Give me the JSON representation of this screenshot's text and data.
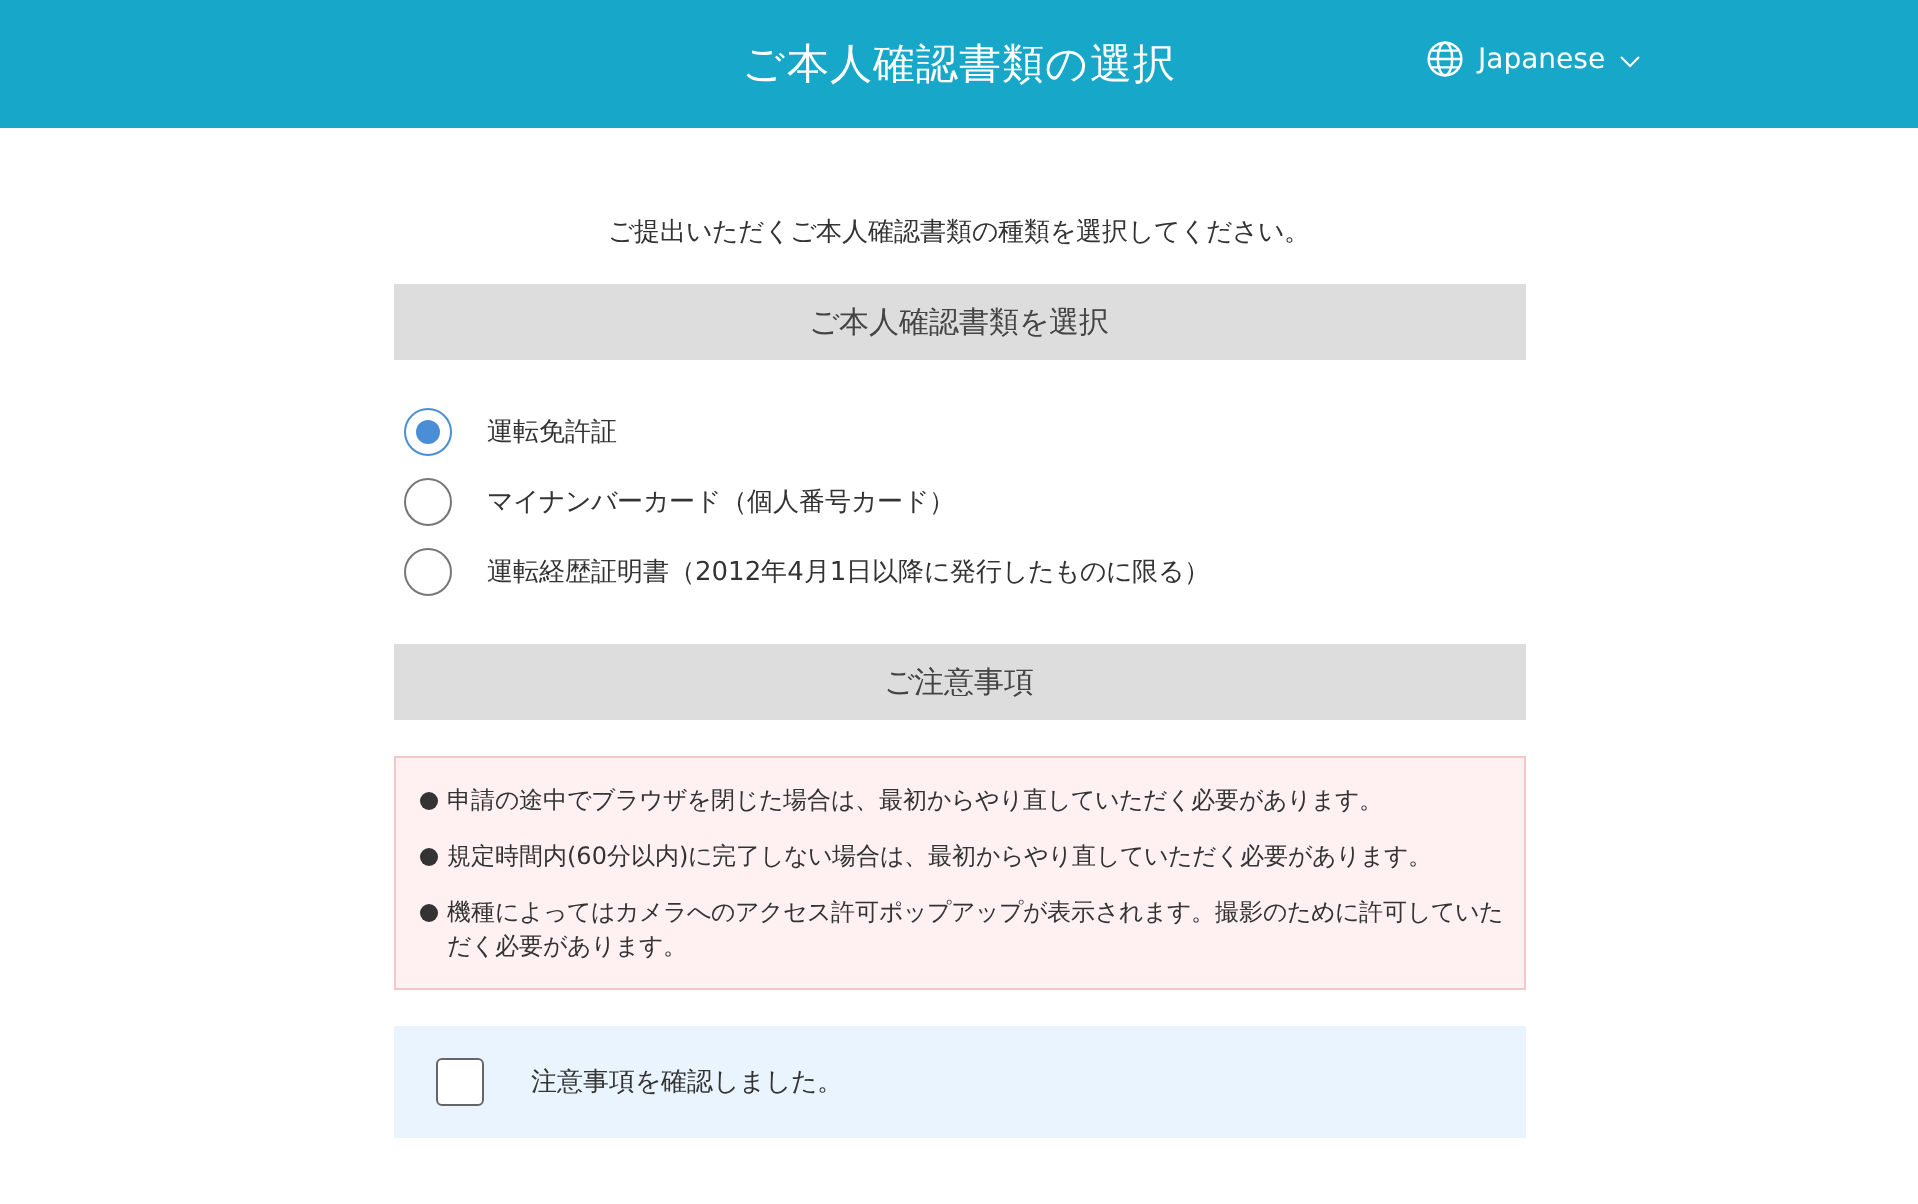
{
  "header": {
    "title": "ご本人確認書類の選択",
    "language": {
      "label": "Japanese"
    }
  },
  "intro": "ご提出いただくご本人確認書類の種類を選択してください。",
  "document_section": {
    "heading": "ご本人確認書類を選択",
    "options": [
      {
        "label": "運転免許証",
        "selected": true
      },
      {
        "label": "マイナンバーカード（個人番号カード）",
        "selected": false
      },
      {
        "label": "運転経歴証明書（2012年4月1日以降に発行したものに限る）",
        "selected": false
      }
    ]
  },
  "notice_section": {
    "heading": "ご注意事項",
    "notes": [
      "申請の途中でブラウザを閉じた場合は、最初からやり直していただく必要があります。",
      "規定時間内(60分以内)に完了しない場合は、最初からやり直していただく必要があります。",
      "機種によってはカメラへのアクセス許可ポップアップが表示されます。撮影のために許可していただく必要があります。"
    ]
  },
  "confirmation": {
    "label": "注意事項を確認しました。",
    "checked": false
  }
}
